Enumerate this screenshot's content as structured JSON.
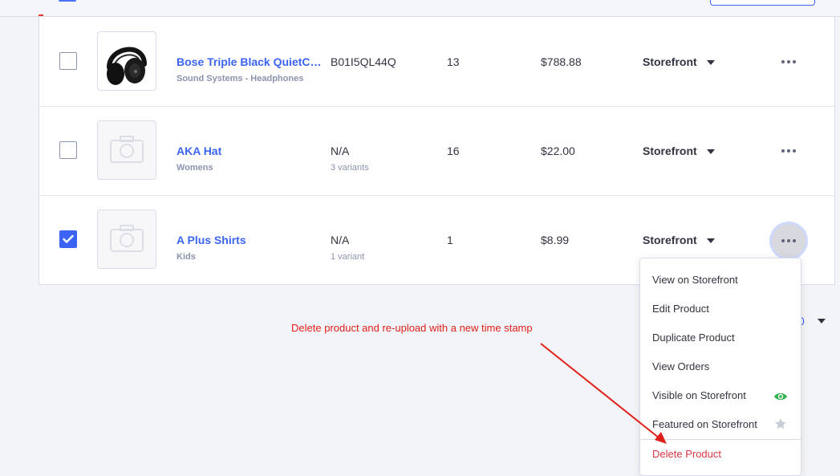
{
  "colors": {
    "accent": "#3c64f4",
    "text": "#313440",
    "muted": "#8c93ad",
    "danger": "#db3643",
    "annotation": "#e0201b",
    "visible_icon": "#33b34f"
  },
  "products": [
    {
      "name": "Bose Triple Black QuietComfort",
      "category": "Sound Systems - Headphones",
      "sku": "B01I5QL44Q",
      "variants": "",
      "stock": "13",
      "price": "$788.88",
      "channel": "Storefront",
      "checked": false,
      "image": "headphones"
    },
    {
      "name": "AKA Hat",
      "category": "Womens",
      "sku": "N/A",
      "variants": "3 variants",
      "stock": "16",
      "price": "$22.00",
      "channel": "Storefront",
      "checked": false,
      "image": "placeholder-camera-icon"
    },
    {
      "name": "A Plus Shirts",
      "category": "Kids",
      "sku": "N/A",
      "variants": "1 variant",
      "stock": "1",
      "price": "$8.99",
      "channel": "Storefront",
      "checked": true,
      "image": "placeholder-camera-icon"
    }
  ],
  "pagination": {
    "value": "0"
  },
  "action_menu": {
    "items": [
      {
        "label": "View on Storefront"
      },
      {
        "label": "Edit Product"
      },
      {
        "label": "Duplicate Product"
      },
      {
        "label": "View Orders"
      },
      {
        "label": "Visible on Storefront",
        "icon": "eye-icon"
      },
      {
        "label": "Featured on Storefront",
        "icon": "star-icon"
      },
      {
        "label": "Delete Product",
        "style": "danger"
      }
    ]
  },
  "annotation": {
    "text": "Delete product and re-upload with a new time stamp"
  }
}
